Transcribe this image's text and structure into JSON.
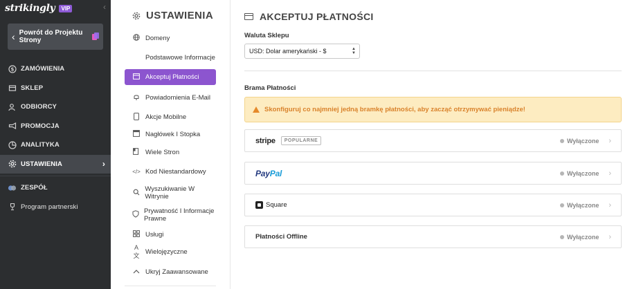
{
  "app": {
    "brand": "strikingly",
    "badge": "VIP"
  },
  "sidebar": {
    "back_button": "Powrót do Projektu Strony",
    "items": [
      {
        "label": "ZAMÓWIENIA",
        "icon": "dollar-icon"
      },
      {
        "label": "SKLEP",
        "icon": "store-icon"
      },
      {
        "label": "ODBIORCY",
        "icon": "users-icon"
      },
      {
        "label": "PROMOCJA",
        "icon": "megaphone-icon"
      },
      {
        "label": "ANALITYKA",
        "icon": "chart-icon"
      },
      {
        "label": "USTAWIENIA",
        "icon": "gear-icon"
      }
    ],
    "team": "ZESPÓŁ",
    "partner": "Program partnerski"
  },
  "settings": {
    "title": "USTAWIENIA",
    "menu": [
      {
        "label": "Domeny",
        "icon": "globe-icon"
      },
      {
        "label": "Podstawowe Informacje",
        "icon": "info-icon"
      },
      {
        "label": "Akceptuj Płatności",
        "icon": "card-icon"
      },
      {
        "label": "Powiadomienia E-Mail",
        "icon": "bell-icon"
      },
      {
        "label": "Akcje Mobilne",
        "icon": "mobile-icon"
      },
      {
        "label": "Nagłówek I Stopka",
        "icon": "header-icon"
      },
      {
        "label": "Wiele Stron",
        "icon": "pages-icon"
      },
      {
        "label": "Kod Niestandardowy",
        "icon": "code-icon"
      },
      {
        "label": "Wyszukiwanie W Witrynie",
        "icon": "search-icon"
      },
      {
        "label": "Prywatność I Informacje Prawne",
        "icon": "shield-icon"
      },
      {
        "label": "Usługi",
        "icon": "grid-icon"
      },
      {
        "label": "Wielojęzyczne",
        "icon": "translate-icon"
      },
      {
        "label": "Ukryj Zaawansowane",
        "icon": "chevron-up-icon"
      }
    ]
  },
  "main": {
    "title": "AKCEPTUJ PŁATNOŚCI",
    "currency_label": "Waluta Sklepu",
    "currency_value": "USD: Dolar amerykański - $",
    "gateway_label": "Brama Płatności",
    "alert": "Skonfiguruj co najmniej jedną bramkę płatności, aby zacząć otrzymywać pieniądze!",
    "gateways": {
      "stripe": {
        "name": "stripe",
        "badge": "POPULARNE",
        "status": "Wyłączone"
      },
      "paypal": {
        "name_a": "Pay",
        "name_b": "Pal",
        "status": "Wyłączone"
      },
      "square": {
        "name": "Square",
        "status": "Wyłączone"
      },
      "offline": {
        "name": "Płatności Offline",
        "status": "Wyłączone"
      }
    }
  },
  "colors": {
    "sidebar_bg": "#2c2e30",
    "accent": "#8c55cf",
    "alert_bg": "#fdecc1",
    "alert_text": "#d9822b"
  }
}
